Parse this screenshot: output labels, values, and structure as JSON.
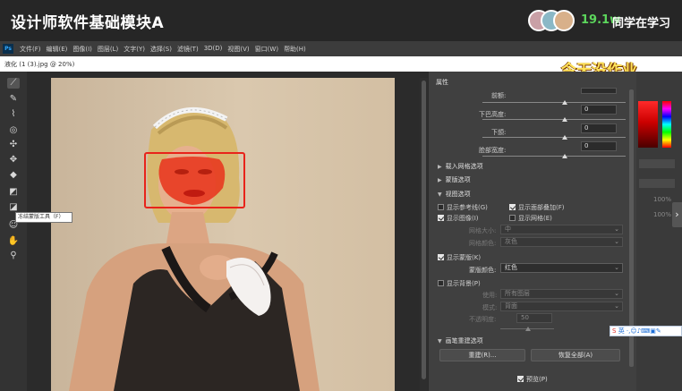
{
  "course": {
    "title": "设计师软件基础模块A",
    "viewer_count": "19.1w",
    "viewer_label": "同学在学习"
  },
  "photoshop": {
    "logo": "Ps",
    "menu": [
      "文件(F)",
      "编辑(E)",
      "图像(I)",
      "图层(L)",
      "文字(Y)",
      "选择(S)",
      "滤镜(T)",
      "3D(D)",
      "视图(V)",
      "窗口(W)",
      "帮助(H)"
    ],
    "document_tab": "液化 (1 (3).jpg @ 20%)",
    "overlay_caption": "今天没作业",
    "tooltip": "冻结蒙版工具（F）",
    "tools": [
      "forward-warp-icon",
      "reconstruct-icon",
      "smooth-icon",
      "twirl-icon",
      "pucker-icon",
      "bloat-icon",
      "push-left-icon",
      "freeze-mask-icon",
      "thaw-mask-icon",
      "face-tool-icon",
      "hand-icon",
      "zoom-icon"
    ]
  },
  "properties": {
    "title": "属性",
    "sliders": [
      {
        "label": "前额:",
        "value": ""
      },
      {
        "label": "下巴高度:",
        "value": "0"
      },
      {
        "label": "下颌:",
        "value": "0"
      },
      {
        "label": "脸部宽度:",
        "value": "0"
      }
    ],
    "sections": {
      "load_mesh": "载入网格选项",
      "mask_options": "蒙版选项",
      "view_options": "视图选项",
      "brush_reconstruct": "画笔重建选项"
    },
    "view_checkboxes": [
      {
        "label": "显示参考线(G)",
        "checked": false
      },
      {
        "label": "显示面部叠加(F)",
        "checked": true
      },
      {
        "label": "显示图像(I)",
        "checked": true
      },
      {
        "label": "显示网格(E)",
        "checked": false
      }
    ],
    "mesh_size_label": "网格大小:",
    "mesh_size_value": "中",
    "mesh_color_label": "网格颜色:",
    "mesh_color_value": "灰色",
    "show_mask_label": "显示蒙版(K)",
    "mask_color_label": "蒙版颜色:",
    "mask_color_value": "红色",
    "show_backdrop_label": "显示背景(P)",
    "use_label": "使用:",
    "use_value": "所有图层",
    "mode_label": "模式:",
    "mode_value": "背面",
    "opacity_label": "不透明度:",
    "opacity_value": "50",
    "reconstruct_button": "重建(R)...",
    "restore_all_button": "恢复全部(A)",
    "preview_label": "预览(P)"
  },
  "right_panel": {
    "zoom_a": "100%",
    "zoom_b": "100%"
  },
  "ime_bar": {
    "label": "英"
  },
  "colors": {
    "mask": "#e8231a",
    "caption": "#ffe35a",
    "viewer_count": "#5cd65c"
  }
}
